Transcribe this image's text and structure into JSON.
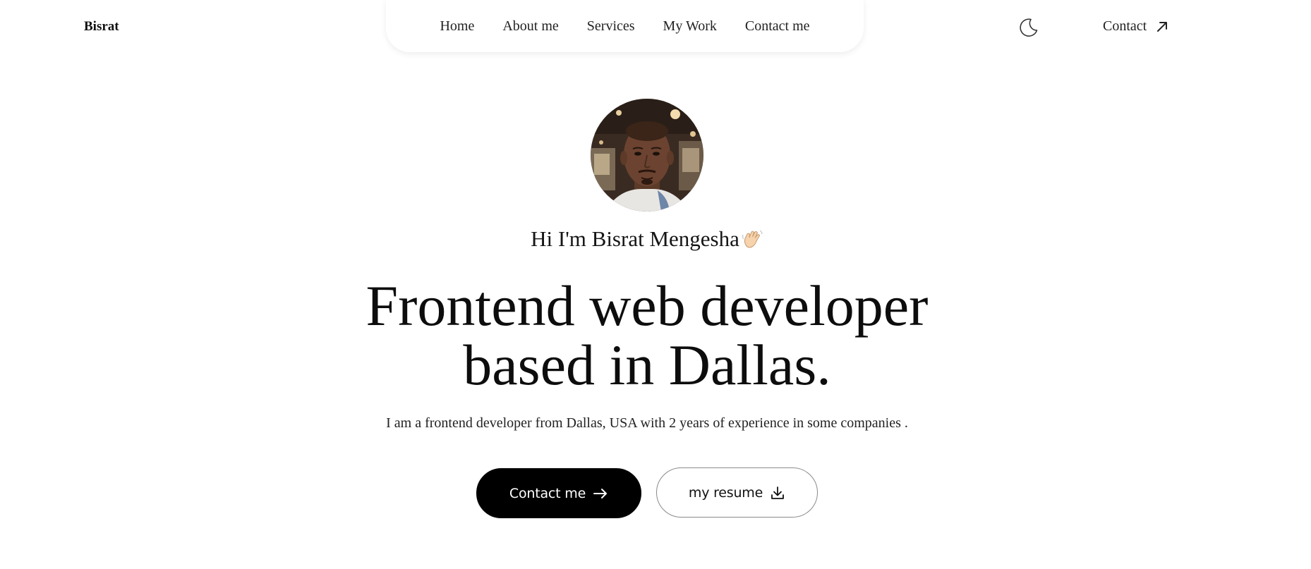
{
  "header": {
    "logo": "Bisrat",
    "nav": [
      {
        "label": "Home"
      },
      {
        "label": "About me"
      },
      {
        "label": "Services"
      },
      {
        "label": "My Work"
      },
      {
        "label": "Contact me"
      }
    ],
    "theme_icon": "moon-icon",
    "contact_label": "Contact",
    "contact_icon": "arrow-up-right-icon"
  },
  "hero": {
    "greeting": "Hi I'm Bisrat Mengesha",
    "greeting_icon": "waving-hand-icon",
    "headline_line1": "Frontend web developer",
    "headline_line2": "based in Dallas.",
    "description": "I am a frontend developer from Dallas, USA with 2 years of experience in some companies .",
    "primary_button": {
      "label": "Contact me",
      "icon": "arrow-right-icon"
    },
    "secondary_button": {
      "label": "my resume",
      "icon": "download-icon"
    }
  },
  "colors": {
    "background": "#ffffff",
    "text": "#111111",
    "primary_button_bg": "#000000",
    "primary_button_text": "#ffffff",
    "secondary_button_border": "#8a8a8a"
  }
}
